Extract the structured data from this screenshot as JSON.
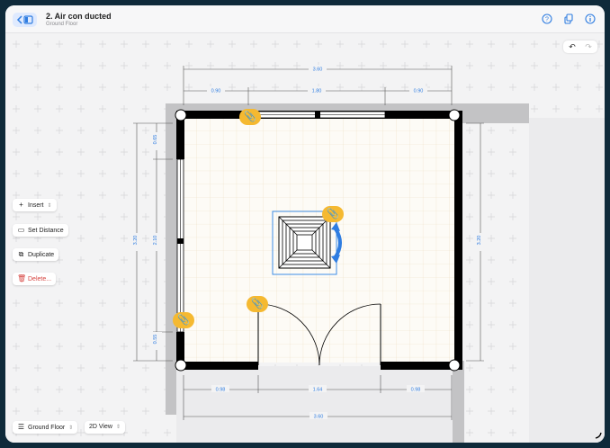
{
  "header": {
    "title": "2. Air con ducted",
    "subtitle": "Ground Floor",
    "back_icon": "chevron-left-icon",
    "sidebar_icon": "sidebar-icon",
    "right_icons": [
      "help-icon",
      "share-icon",
      "info-icon"
    ],
    "accent": "#2f7de1"
  },
  "history": {
    "undo_icon": "undo-icon",
    "redo_icon": "redo-icon"
  },
  "tools": {
    "insert": "Insert",
    "set_distance": "Set Distance",
    "duplicate": "Duplicate",
    "delete": "Delete..."
  },
  "footer": {
    "floor_label": "Ground Floor",
    "view_label": "2D View"
  },
  "dimensions": {
    "top_total": "3.60",
    "top_left": "0.90",
    "top_mid": "1.80",
    "top_right": "0.90",
    "left_total": "3.20",
    "left_top": "0.65",
    "left_mid": "2.10",
    "left_bottom": "0.55",
    "right_total": "3.20",
    "bottom_left": "0.98",
    "bottom_mid": "1.64",
    "bottom_right": "0.98",
    "bottom_total": "3.60"
  },
  "colors": {
    "wall": "#000000",
    "dimension": "#2f7de1",
    "attachment_badge": "#f5b931",
    "selection": "#3d8ee6"
  }
}
